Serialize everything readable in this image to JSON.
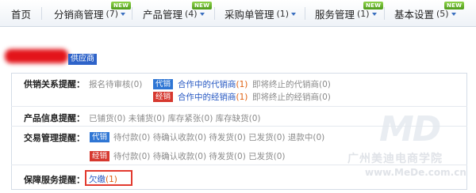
{
  "nav": {
    "home": "首页",
    "distributor": {
      "label": "分销商管理",
      "count": "(7)",
      "badge": "NEW"
    },
    "product": {
      "label": "产品管理",
      "count": "(4)",
      "badge": "NEW"
    },
    "purchase": {
      "label": "采购单管理",
      "count": "(1)"
    },
    "service": {
      "label": "服务管理",
      "count": "(1)",
      "badge": "NEW"
    },
    "settings": {
      "label": "基本设置",
      "count": "(5)",
      "badge": "NEW"
    }
  },
  "supplier_tag": "供应商",
  "sections": {
    "relation": {
      "label": "供销关系提醒：",
      "pending_text": "报名待审核",
      "pending_count": "(0)",
      "tag1": "代销",
      "tag1_link": "合作中的代销商",
      "tag1_count": "(1)",
      "tag1_expire": "即将终止的代销商(0)",
      "tag2": "经销",
      "tag2_link": "合作中的经销商",
      "tag2_count": "(1)",
      "tag2_expire": "即将终止的经销商(0)"
    },
    "product": {
      "label": "产品信息提醒：",
      "text": "已铺货(0) 未铺货(0) 库存紧张(0) 库存缺货(0)"
    },
    "trade": {
      "label": "交易管理提醒：",
      "tag1": "代销",
      "line1": "待付款(0) 待确认收款(0) 待发货(0) 已发货(0) 退款中(0)",
      "tag2": "经销",
      "line2": "待付款(0) 待确认收款(0) 待发货(0) 已发货(0)"
    },
    "guarantee": {
      "label": "保障服务提醒：",
      "link": "欠缴",
      "count": "(1)"
    }
  },
  "watermark": {
    "logo": "MD",
    "name": "广州美迪电商学院",
    "url": "www.MeDe.com.cn"
  },
  "colors": {
    "link": "#2557c2",
    "count": "#e06010",
    "tag_blue": "#2f76d4",
    "tag_red": "#d6382f",
    "badge_green": "#5aa824"
  }
}
